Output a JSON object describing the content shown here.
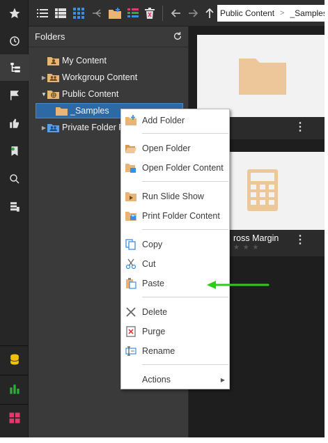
{
  "breadcrumb": {
    "items": [
      "Public Content",
      "_Samples"
    ]
  },
  "folders_panel": {
    "title": "Folders",
    "tree": [
      {
        "label": "My Content",
        "expandable": false,
        "icon": "user-folder-icon"
      },
      {
        "label": "Workgroup Content",
        "expandable": true,
        "icon": "group-folder-icon"
      },
      {
        "label": "Public Content",
        "expandable": true,
        "expanded": true,
        "icon": "globe-folder-icon"
      },
      {
        "label": "_Samples",
        "expandable": false,
        "selected": true,
        "icon": "folder-icon"
      },
      {
        "label": "Private Folder Fo",
        "expandable": true,
        "icon": "private-folder-icon"
      }
    ]
  },
  "content": {
    "cards": [
      {
        "title": "",
        "icon": "folder-icon"
      },
      {
        "title": "ross Margin",
        "icon": "calculator-icon",
        "rating": 0
      }
    ],
    "kebab": "⋮"
  },
  "context_menu": {
    "items": [
      {
        "label": "Add Folder",
        "icon": "add-folder-icon",
        "enabled": true
      },
      {
        "label": "Open Folder",
        "icon": "open-folder-icon",
        "enabled": true
      },
      {
        "label": "Open Folder Content",
        "icon": "open-folder-content-icon",
        "enabled": true
      },
      {
        "label": "Run Slide Show",
        "icon": "slideshow-icon",
        "enabled": true
      },
      {
        "label": "Print Folder Content",
        "icon": "print-icon",
        "enabled": true
      },
      {
        "label": "Copy",
        "icon": "copy-icon",
        "enabled": true
      },
      {
        "label": "Cut",
        "icon": "cut-icon",
        "enabled": true
      },
      {
        "label": "Paste",
        "icon": "paste-icon",
        "enabled": true
      },
      {
        "label": "Delete",
        "icon": "delete-icon",
        "enabled": true
      },
      {
        "label": "Purge",
        "icon": "purge-icon",
        "enabled": true
      },
      {
        "label": "Rename",
        "icon": "rename-icon",
        "enabled": true
      },
      {
        "label": "Actions",
        "icon": "",
        "enabled": true,
        "submenu": true
      }
    ]
  },
  "colors": {
    "folder": "#e8b577",
    "selection": "#2d6aa5",
    "annotation_arrow": "#2ecc1a",
    "rail_db": "#f2c200",
    "rail_chart": "#2eab3a",
    "rail_grid": "#e23a6c"
  }
}
